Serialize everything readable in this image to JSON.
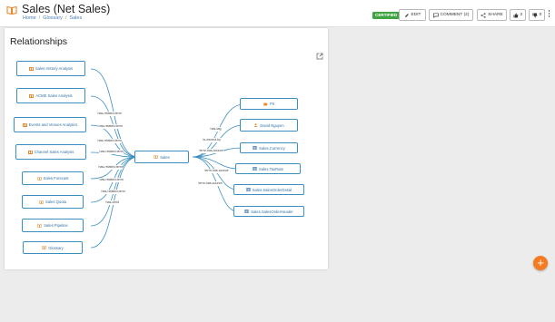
{
  "header": {
    "title": "Sales (Net Sales)",
    "breadcrumb": [
      "Home",
      "Glossary",
      "Sales"
    ],
    "certified_badge": "CERTIFIED",
    "edit_label": "EDIT",
    "comment_label": "COMMENT (2)",
    "share_label": "SHARE",
    "likes": "2",
    "dislikes": "0"
  },
  "panel": {
    "title": "Relationships"
  },
  "graph": {
    "center": "Sales",
    "left_nodes": [
      "Sales History Analysis",
      "ACME Sales Analysis",
      "Events and Venues Analytics",
      "Channel Sales Analysis",
      "Sales Forecast",
      "Sales Quota",
      "Sales Pipeline",
      "Glossary"
    ],
    "right_nodes": [
      "PII",
      "David Nguyen",
      "Sales.Currency",
      "Sales.TaxRate",
      "Sales.SalesOrderDetail",
      "Sales.SalesOrderHeader"
    ],
    "edge_labels": [
      "has-related-term",
      "has-related-term",
      "has-related-term",
      "has-related-term",
      "has-related-term",
      "has-related-term",
      "has-related-term",
      "has-child",
      "has-tag",
      "is-owned-by",
      "term-has-source",
      "term-has-source",
      "term-has-source"
    ]
  },
  "colors": {
    "accent": "#3b8fbf",
    "certified": "#3fa342",
    "fab": "#f47b20",
    "book_icon": "#e8892b"
  },
  "fab_label": "+"
}
